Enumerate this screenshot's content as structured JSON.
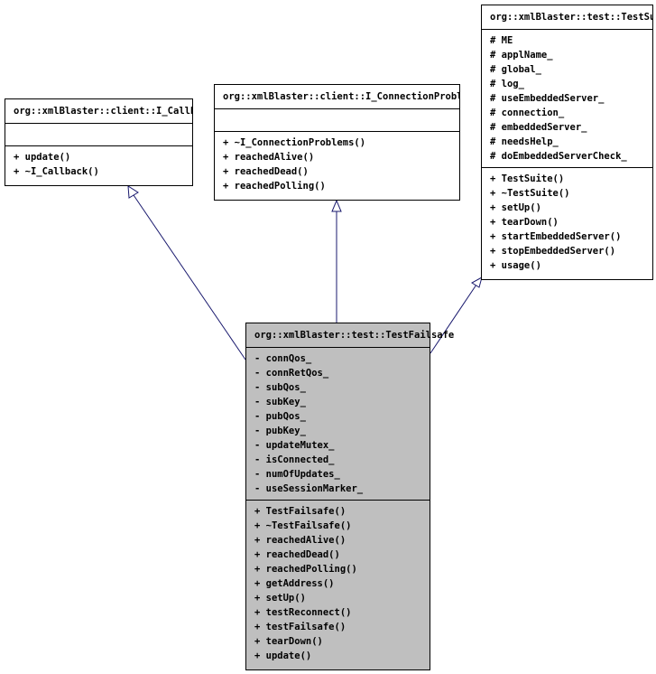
{
  "classes": {
    "callback": {
      "name": "org::xmlBlaster::client::I_Callback",
      "attributes": [],
      "methods": [
        "+ update()",
        "+ ~I_Callback()"
      ]
    },
    "connection_problems": {
      "name": "org::xmlBlaster::client::I_ConnectionProblems",
      "attributes": [],
      "methods": [
        "+ ~I_ConnectionProblems()",
        "+ reachedAlive()",
        "+ reachedDead()",
        "+ reachedPolling()"
      ]
    },
    "test_suite": {
      "name": "org::xmlBlaster::test::TestSuite",
      "attributes": [
        "# ME",
        "# applName_",
        "# global_",
        "# log_",
        "# useEmbeddedServer_",
        "# connection_",
        "# embeddedServer_",
        "# needsHelp_",
        "# doEmbeddedServerCheck_"
      ],
      "methods": [
        "+ TestSuite()",
        "+ ~TestSuite()",
        "+ setUp()",
        "+ tearDown()",
        "+ startEmbeddedServer()",
        "+ stopEmbeddedServer()",
        "+ usage()"
      ]
    },
    "test_failsafe": {
      "name": "org::xmlBlaster::test::TestFailsafe",
      "attributes": [
        "- connQos_",
        "- connRetQos_",
        "- subQos_",
        "- subKey_",
        "- pubQos_",
        "- pubKey_",
        "- updateMutex_",
        "- isConnected_",
        "- numOfUpdates_",
        "- useSessionMarker_"
      ],
      "methods": [
        "+ TestFailsafe()",
        "+ ~TestFailsafe()",
        "+ reachedAlive()",
        "+ reachedDead()",
        "+ reachedPolling()",
        "+ getAddress()",
        "+ setUp()",
        "+ testReconnect()",
        "+ testFailsafe()",
        "+ tearDown()",
        "+ update()"
      ]
    }
  },
  "relations": [
    {
      "from": "test_failsafe",
      "to": "callback",
      "type": "inheritance"
    },
    {
      "from": "test_failsafe",
      "to": "connection_problems",
      "type": "inheritance"
    },
    {
      "from": "test_failsafe",
      "to": "test_suite",
      "type": "inheritance"
    }
  ],
  "colors": {
    "edge": "#1a1a6e",
    "focus_fill": "#bfbfbf",
    "box_fill": "#ffffff"
  }
}
